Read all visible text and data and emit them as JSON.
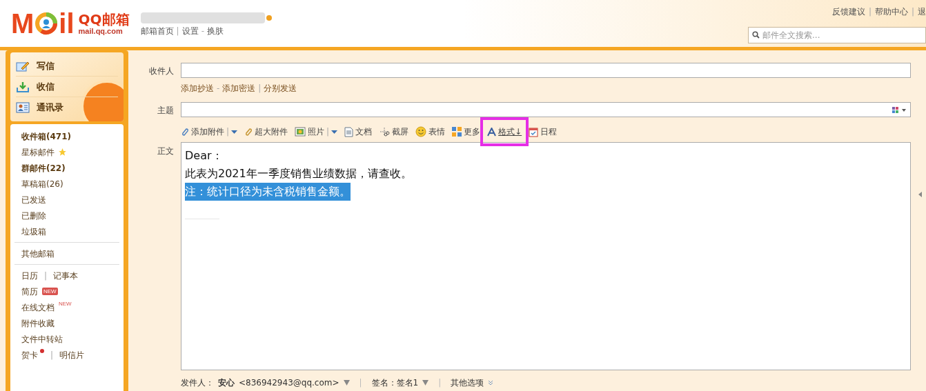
{
  "header": {
    "logo": {
      "left": "M",
      "right": "il"
    },
    "brand": {
      "name": "QQ邮箱",
      "domain": "mail.qq.com"
    },
    "nav": [
      "邮箱首页",
      "|",
      "设置",
      "-",
      "换肤"
    ],
    "top_links": [
      "反馈建议",
      "|",
      "帮助中心",
      "|",
      "退"
    ],
    "search": {
      "placeholder": "邮件全文搜索..."
    }
  },
  "sidebar": {
    "actions": [
      {
        "label": "写信",
        "kind": "write"
      },
      {
        "label": "收信",
        "kind": "receive"
      },
      {
        "label": "通讯录",
        "kind": "contacts"
      }
    ],
    "groups": [
      [
        {
          "label": "收件箱(471)",
          "bold": true
        },
        {
          "label": "星标邮件",
          "bold": false,
          "star": true
        },
        {
          "label": "群邮件(22)",
          "bold": true
        },
        {
          "label": "草稿箱(26)",
          "bold": false
        },
        {
          "label": "已发送",
          "bold": false
        },
        {
          "label": "已删除",
          "bold": false
        },
        {
          "label": "垃圾箱",
          "bold": false
        }
      ],
      [
        {
          "label": "其他邮箱",
          "bold": false
        }
      ],
      [
        {
          "label": "日历",
          "bold": false,
          "divider": "|",
          "pair": "记事本"
        },
        {
          "label": "简历",
          "bold": false,
          "badge": {
            "text": "NEW",
            "kind": "box"
          }
        },
        {
          "label": "在线文档",
          "bold": false,
          "badge": {
            "text": "NEW",
            "kind": "sup"
          }
        },
        {
          "label": "附件收藏",
          "bold": false
        },
        {
          "label": "文件中转站",
          "bold": false
        },
        {
          "label": "贺卡",
          "bold": false,
          "dot": true,
          "divider": "|",
          "pair": "明信片"
        }
      ]
    ]
  },
  "compose": {
    "to_label": "收件人",
    "to_links": [
      "添加抄送",
      "-",
      "添加密送",
      "|",
      "分别发送"
    ],
    "subject_label": "主题",
    "toolbar": [
      {
        "label": "添加附件",
        "kind": "clip",
        "split": "|",
        "highlighted": false
      },
      {
        "label": "超大附件",
        "kind": "bigclip",
        "highlighted": false
      },
      {
        "label": "照片",
        "kind": "photo",
        "split": "|",
        "highlighted": false
      },
      {
        "label": "文档",
        "kind": "doc",
        "highlighted": false
      },
      {
        "label": "截屏",
        "kind": "scissors",
        "highlighted": false
      },
      {
        "label": "表情",
        "kind": "smiley",
        "highlighted": false
      },
      {
        "label": "更多",
        "kind": "grid",
        "highlighted": false
      },
      {
        "label": "格式↓",
        "kind": "font",
        "highlighted": true
      },
      {
        "label": "日程",
        "kind": "calendar",
        "highlighted": false
      }
    ],
    "body_label": "正文",
    "body_lines": [
      {
        "text": "Dear：",
        "selected": false
      },
      {
        "text": "此表为2021年一季度销售业绩数据，请查收。",
        "selected": false
      },
      {
        "text": "注：统计口径为未含税销售金额。",
        "selected": true
      }
    ],
    "footer": {
      "sender_label": "发件人：",
      "sender_name": "安心",
      "sender_email": "<836942943@qq.com>",
      "dividers": [
        "|",
        "|"
      ],
      "signature": "签名：签名1",
      "options": "其他选项"
    }
  }
}
